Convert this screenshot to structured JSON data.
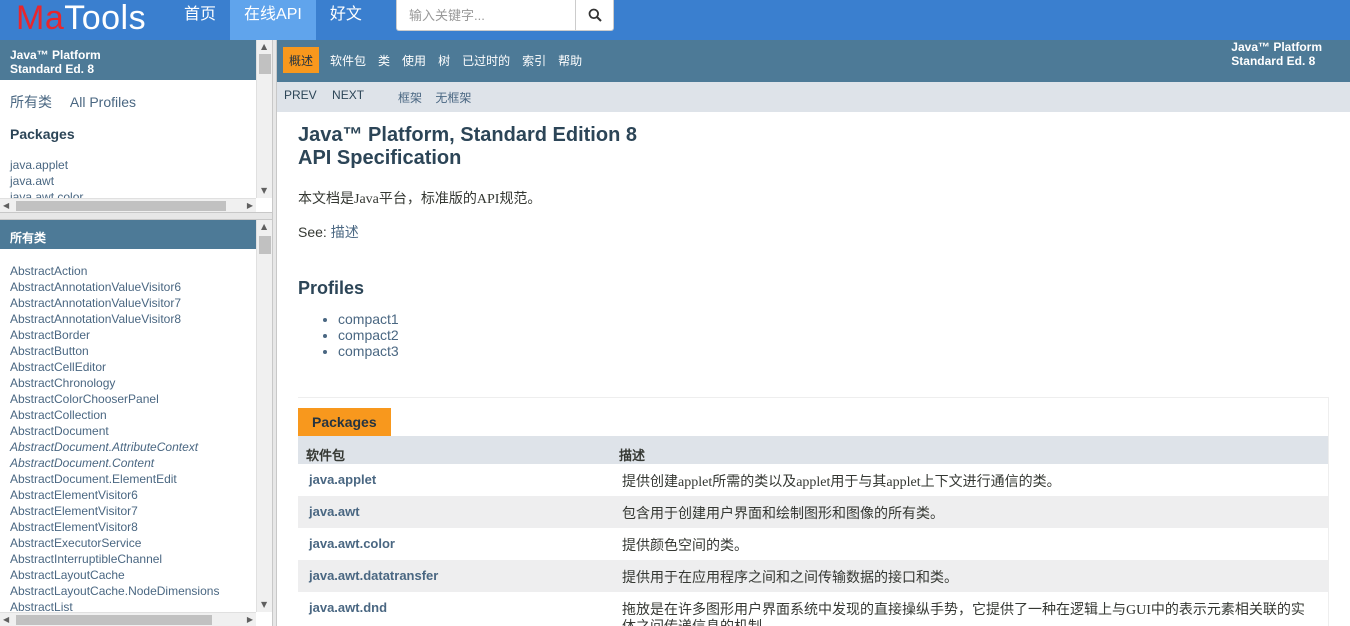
{
  "logo": {
    "ma": "Ma",
    "tools": "Tools"
  },
  "nav": [
    {
      "label": "首页"
    },
    {
      "label": "在线API"
    },
    {
      "label": "好文"
    }
  ],
  "search": {
    "placeholder": "输入关键字...",
    "value": ""
  },
  "left_top": {
    "header_line1": "Java™ Platform",
    "header_line2": "Standard Ed. 8",
    "all_classes": "所有类",
    "all_profiles": "All Profiles",
    "packages_heading": "Packages",
    "packages": [
      "java.applet",
      "java.awt",
      "java.awt.color"
    ]
  },
  "left_bottom": {
    "header": "所有类",
    "classes": [
      "AbstractAction",
      "AbstractAnnotationValueVisitor6",
      "AbstractAnnotationValueVisitor7",
      "AbstractAnnotationValueVisitor8",
      "AbstractBorder",
      "AbstractButton",
      "AbstractCellEditor",
      "AbstractChronology",
      "AbstractColorChooserPanel",
      "AbstractCollection",
      "AbstractDocument",
      "AbstractDocument.AttributeContext",
      "AbstractDocument.Content",
      "AbstractDocument.ElementEdit",
      "AbstractElementVisitor6",
      "AbstractElementVisitor7",
      "AbstractElementVisitor8",
      "AbstractExecutorService",
      "AbstractInterruptibleChannel",
      "AbstractLayoutCache",
      "AbstractLayoutCache.NodeDimensions",
      "AbstractList"
    ]
  },
  "topnav": {
    "items": [
      "概述",
      "软件包",
      "类",
      "使用",
      "树",
      "已过时的",
      "索引",
      "帮助"
    ],
    "about_line1": "Java™ Platform",
    "about_line2": "Standard Ed. 8"
  },
  "subnav": {
    "prev": "PREV",
    "next": "NEXT",
    "frames": "框架",
    "no_frames": "无框架"
  },
  "content": {
    "title_line1": "Java™ Platform, Standard Edition 8",
    "title_line2": "API Specification",
    "description": "本文档是Java平台，标准版的API规范。",
    "see_label": "See:",
    "see_link": "描述",
    "profiles_heading": "Profiles",
    "profiles": [
      "compact1",
      "compact2",
      "compact3"
    ]
  },
  "packages_table": {
    "caption": "Packages",
    "col_package": "软件包",
    "col_description": "描述",
    "rows": [
      {
        "name": "java.applet",
        "desc": "提供创建applet所需的类以及applet用于与其applet上下文进行通信的类。"
      },
      {
        "name": "java.awt",
        "desc": "包含用于创建用户界面和绘制图形和图像的所有类。"
      },
      {
        "name": "java.awt.color",
        "desc": "提供颜色空间的类。"
      },
      {
        "name": "java.awt.datatransfer",
        "desc": "提供用于在应用程序之间和之间传输数据的接口和类。"
      },
      {
        "name": "java.awt.dnd",
        "desc": "拖放是在许多图形用户界面系统中发现的直接操纵手势，它提供了一种在逻辑上与GUI中的表示元素相关联的实体之间传递信息的机制"
      }
    ]
  }
}
